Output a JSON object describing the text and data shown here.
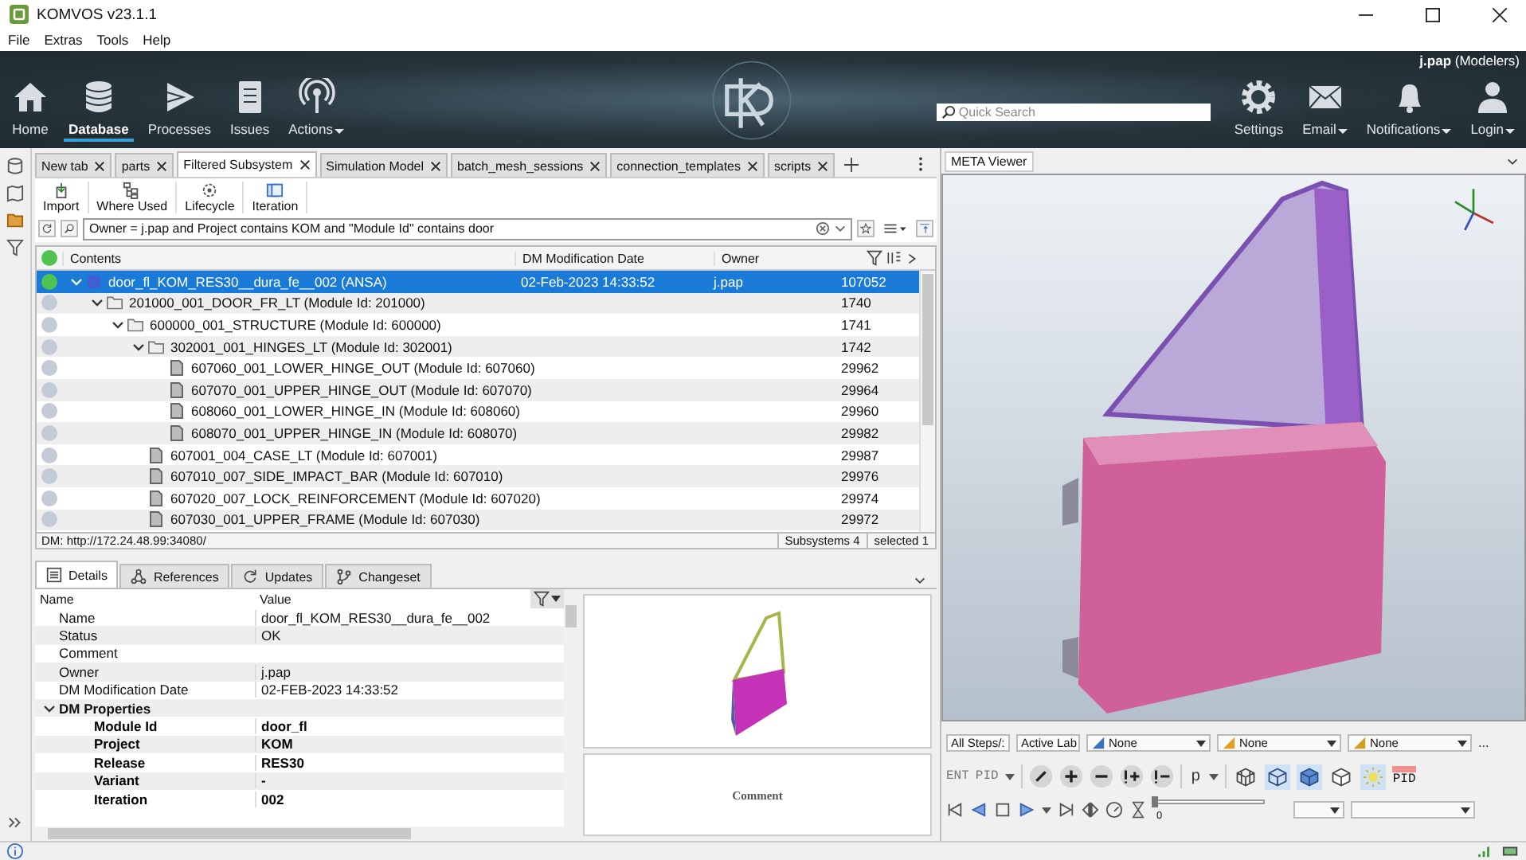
{
  "window": {
    "title": "KOMVOS v23.1.1"
  },
  "menu": [
    "File",
    "Extras",
    "Tools",
    "Help"
  ],
  "ribbon": {
    "left": [
      {
        "label": "Home",
        "kind": "home",
        "selected": false,
        "dropdown": false
      },
      {
        "label": "Database",
        "kind": "database",
        "selected": true,
        "dropdown": false
      },
      {
        "label": "Processes",
        "kind": "processes",
        "selected": false,
        "dropdown": false
      },
      {
        "label": "Issues",
        "kind": "issues",
        "selected": false,
        "dropdown": false
      },
      {
        "label": "Actions",
        "kind": "actions",
        "selected": false,
        "dropdown": true
      }
    ],
    "user": "**j.pap** (Modelers)",
    "search": {
      "placeholder": "Quick Search"
    },
    "right": [
      {
        "label": "Settings",
        "kind": "gear",
        "dropdown": false
      },
      {
        "label": "Email",
        "kind": "mail",
        "dropdown": true
      },
      {
        "label": "Notifications",
        "kind": "bell",
        "dropdown": true
      },
      {
        "label": "Login",
        "kind": "person",
        "dropdown": true
      }
    ]
  },
  "tabs": [
    {
      "label": "New tab",
      "selected": false
    },
    {
      "label": "parts",
      "selected": false
    },
    {
      "label": "Filtered Subsystem",
      "selected": true
    },
    {
      "label": "Simulation Model",
      "selected": false
    },
    {
      "label": "batch_mesh_sessions",
      "selected": false
    },
    {
      "label": "connection_templates",
      "selected": false
    },
    {
      "label": "scripts",
      "selected": false
    }
  ],
  "actions": [
    {
      "label": "Import",
      "kind": "import"
    },
    {
      "label": "Where Used",
      "kind": "where"
    },
    {
      "label": "Lifecycle",
      "kind": "lifecycle"
    },
    {
      "label": "Iteration",
      "kind": "iteration"
    }
  ],
  "filter": {
    "value": "Owner = j.pap and Project contains KOM and \"Module Id\" contains door"
  },
  "table": {
    "columns": [
      "Contents",
      "DM Modification Date",
      "Owner"
    ],
    "rows": [
      {
        "label": "door_fl_KOM_RES30__dura_fe__002 (ANSA)",
        "date": "02-Feb-2023 14:33:52",
        "owner": "j.pap",
        "id": "107052",
        "color": "#4fc34f",
        "kind": "model",
        "selected": true,
        "expanded": true,
        "children": [
          {
            "label": "201000_001_DOOR_FR_LT (Module Id: 201000)",
            "id": "1740",
            "color": "#c3cbd8",
            "kind": "folder",
            "selected": false,
            "expanded": true,
            "children": [
              {
                "label": "600000_001_STRUCTURE (Module Id: 600000)",
                "id": "1741",
                "color": "#c3cbd8",
                "kind": "folder",
                "selected": false,
                "expanded": true,
                "children": [
                  {
                    "label": "302001_001_HINGES_LT (Module Id: 302001)",
                    "id": "1742",
                    "color": "#c3cbd8",
                    "kind": "folder",
                    "selected": false,
                    "expanded": true,
                    "children": [
                      {
                        "label": "607060_001_LOWER_HINGE_OUT (Module Id: 607060)",
                        "id": "29962",
                        "color": "#c3cbd8",
                        "kind": "part",
                        "selected": false
                      },
                      {
                        "label": "607070_001_UPPER_HINGE_OUT (Module Id: 607070)",
                        "id": "29964",
                        "color": "#c3cbd8",
                        "kind": "part",
                        "selected": false
                      },
                      {
                        "label": "608060_001_LOWER_HINGE_IN (Module Id: 608060)",
                        "id": "29960",
                        "color": "#c3cbd8",
                        "kind": "part",
                        "selected": false
                      },
                      {
                        "label": "608070_001_UPPER_HINGE_IN (Module Id: 608070)",
                        "id": "29982",
                        "color": "#c3cbd8",
                        "kind": "part",
                        "selected": false
                      }
                    ]
                  },
                  {
                    "label": "607001_004_CASE_LT (Module Id: 607001)",
                    "id": "29987",
                    "color": "#c3cbd8",
                    "kind": "part",
                    "selected": false
                  },
                  {
                    "label": "607010_007_SIDE_IMPACT_BAR (Module Id: 607010)",
                    "id": "29976",
                    "color": "#c3cbd8",
                    "kind": "part",
                    "selected": false
                  },
                  {
                    "label": "607020_007_LOCK_REINFORCEMENT (Module Id: 607020)",
                    "id": "29974",
                    "color": "#c3cbd8",
                    "kind": "part",
                    "selected": false
                  },
                  {
                    "label": "607030_001_UPPER_FRAME (Module Id: 607030)",
                    "id": "29972",
                    "color": "#c3cbd8",
                    "kind": "part",
                    "selected": false
                  }
                ]
              }
            ]
          }
        ]
      }
    ]
  },
  "status_bar": {
    "url": "DM: http://172.24.48.99:34080/",
    "count": "Subsystems 4",
    "selection": "selected 1"
  },
  "details": {
    "tabs": [
      {
        "label": "Details",
        "kind": "details",
        "selected": true
      },
      {
        "label": "References",
        "kind": "references",
        "selected": false
      },
      {
        "label": "Updates",
        "kind": "updates",
        "selected": false
      },
      {
        "label": "Changeset",
        "kind": "changeset",
        "selected": false
      }
    ],
    "columns": [
      "Name",
      "Value"
    ],
    "rows": [
      {
        "name": "Name",
        "value": "door_fl_KOM_RES30__dura_fe__002",
        "kind": "field"
      },
      {
        "name": "Status",
        "value": "OK",
        "kind": "field"
      },
      {
        "name": "Comment",
        "value": "",
        "kind": "field"
      },
      {
        "name": "Owner",
        "value": "j.pap",
        "kind": "field"
      },
      {
        "name": "DM Modification Date",
        "value": "02-FEB-2023 14:33:52",
        "kind": "field"
      },
      {
        "name": "DM Properties",
        "kind": "group",
        "expanded": true,
        "children": [
          {
            "name": "Module Id",
            "value": "door_fl",
            "kind": "property"
          },
          {
            "name": "Project",
            "value": "KOM",
            "kind": "property"
          },
          {
            "name": "Release",
            "value": "RES30",
            "kind": "property"
          },
          {
            "name": "Variant",
            "value": "-",
            "kind": "property"
          },
          {
            "name": "Iteration",
            "value": "002",
            "kind": "property"
          }
        ]
      }
    ]
  },
  "preview": {
    "caption": "Comment"
  },
  "viewer": {
    "title": "META Viewer",
    "dropdowns": [
      {
        "label": "All Steps/:",
        "kind": "small"
      },
      {
        "label": "Active Lab",
        "kind": "small"
      },
      {
        "label": "None",
        "kind": "wide"
      },
      {
        "label": "None",
        "kind": "wide"
      },
      {
        "label": "None",
        "kind": "wide"
      }
    ],
    "more": "...",
    "entity_labels": [
      "ENT",
      "PID"
    ],
    "p_label": "p",
    "pid_label": "PID",
    "slider": {
      "level": 0,
      "reading": "0"
    }
  }
}
